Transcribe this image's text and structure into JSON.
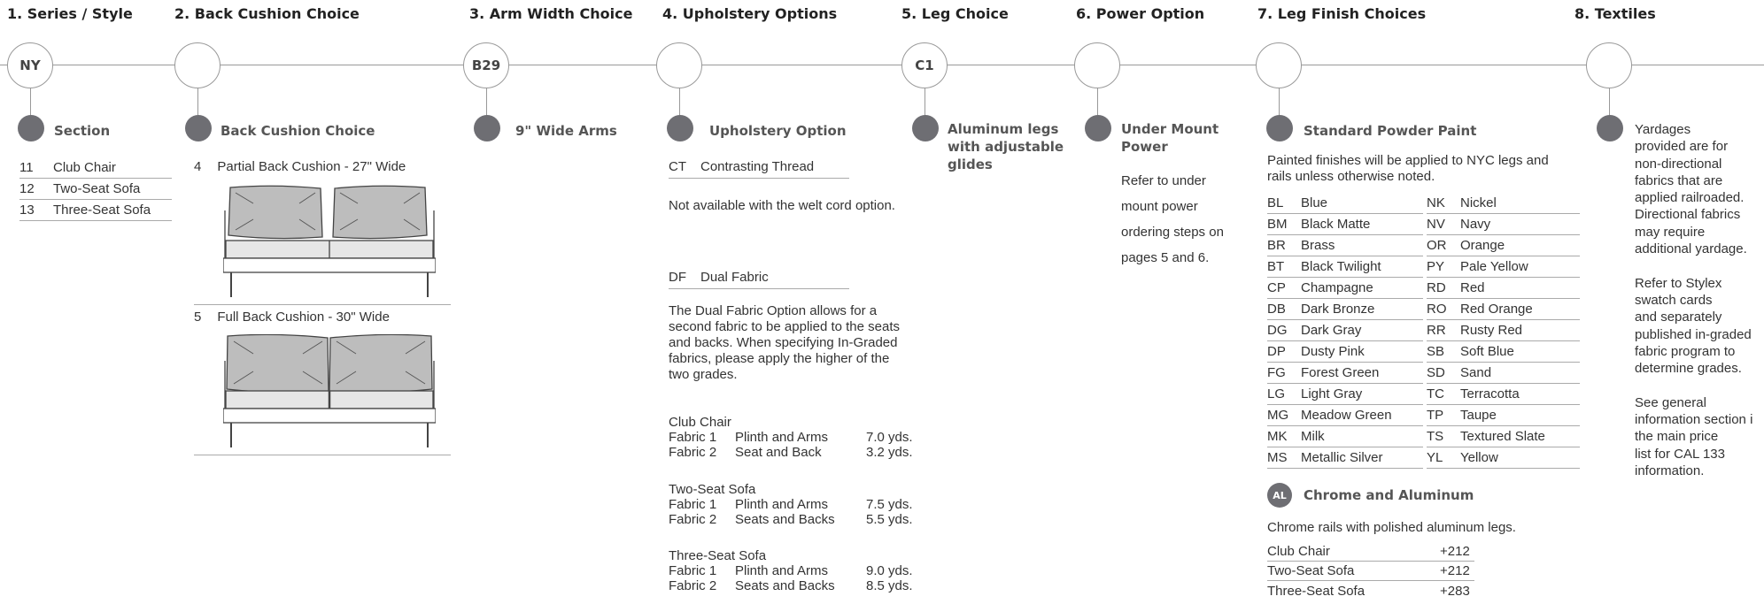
{
  "headers": [
    "1. Series / Style",
    "2. Back Cushion Choice",
    "3. Arm Width Choice",
    "4. Upholstery Options",
    "5. Leg Choice",
    "6. Power Option",
    "7. Leg Finish Choices",
    "8. Textiles"
  ],
  "circles": {
    "series": "NY",
    "arm": "B29",
    "leg": "C1"
  },
  "col1": {
    "heading": "Section",
    "items": [
      {
        "code": "11",
        "label": "Club Chair"
      },
      {
        "code": "12",
        "label": "Two-Seat Sofa"
      },
      {
        "code": "13",
        "label": "Three-Seat Sofa"
      }
    ]
  },
  "col2": {
    "heading": "Back Cushion Choice",
    "options": [
      {
        "code": "4",
        "label": "Partial Back Cushion - 27\" Wide"
      },
      {
        "code": "5",
        "label": "Full Back Cushion - 30\" Wide"
      }
    ]
  },
  "col3": {
    "heading": "9\" Wide Arms"
  },
  "col4": {
    "heading": "Upholstery Option",
    "ct_code": "CT",
    "ct_label": "Contrasting Thread",
    "ct_note": "Not available with the welt cord option.",
    "df_code": "DF",
    "df_label": "Dual Fabric",
    "df_desc": "The Dual Fabric Option allows for a second fabric to be applied to the seats and backs. When specifying In-Graded fabrics, please apply the higher of the two grades.",
    "groups": [
      {
        "title": "Club Chair",
        "rows": [
          {
            "f": "Fabric 1",
            "part": "Plinth and Arms",
            "yds": "7.0 yds."
          },
          {
            "f": "Fabric 2",
            "part": "Seat and Back",
            "yds": "3.2 yds."
          }
        ]
      },
      {
        "title": "Two-Seat Sofa",
        "rows": [
          {
            "f": "Fabric 1",
            "part": "Plinth and Arms",
            "yds": "7.5 yds."
          },
          {
            "f": "Fabric 2",
            "part": "Seats and Backs",
            "yds": "5.5 yds."
          }
        ]
      },
      {
        "title": "Three-Seat Sofa",
        "rows": [
          {
            "f": "Fabric 1",
            "part": "Plinth and Arms",
            "yds": "9.0 yds."
          },
          {
            "f": "Fabric 2",
            "part": "Seats and Backs",
            "yds": "8.5 yds."
          }
        ]
      }
    ]
  },
  "col5": {
    "heading_line1": "Aluminum legs",
    "heading_line2": "with adjustable",
    "heading_line3": "glides"
  },
  "col6": {
    "heading_line1": "Under Mount",
    "heading_line2": "Power",
    "lines": [
      "Refer to under",
      "mount power",
      "ordering steps on",
      "pages 5 and 6."
    ]
  },
  "col7": {
    "heading": "Standard Powder Paint",
    "note_line1": "Painted finishes will be applied to NYC legs and",
    "note_line2": "rails unless otherwise noted.",
    "colors_left": [
      {
        "c": "BL",
        "n": "Blue"
      },
      {
        "c": "BM",
        "n": "Black Matte"
      },
      {
        "c": "BR",
        "n": "Brass"
      },
      {
        "c": "BT",
        "n": "Black Twilight"
      },
      {
        "c": "CP",
        "n": "Champagne"
      },
      {
        "c": "DB",
        "n": "Dark Bronze"
      },
      {
        "c": "DG",
        "n": "Dark Gray"
      },
      {
        "c": "DP",
        "n": "Dusty Pink"
      },
      {
        "c": "FG",
        "n": "Forest Green"
      },
      {
        "c": "LG",
        "n": "Light Gray"
      },
      {
        "c": "MG",
        "n": "Meadow Green"
      },
      {
        "c": "MK",
        "n": "Milk"
      },
      {
        "c": "MS",
        "n": "Metallic Silver"
      }
    ],
    "colors_right": [
      {
        "c": "NK",
        "n": "Nickel"
      },
      {
        "c": "NV",
        "n": "Navy"
      },
      {
        "c": "OR",
        "n": "Orange"
      },
      {
        "c": "PY",
        "n": "Pale Yellow"
      },
      {
        "c": "RD",
        "n": "Red"
      },
      {
        "c": "RO",
        "n": "Red Orange"
      },
      {
        "c": "RR",
        "n": "Rusty Red"
      },
      {
        "c": "SB",
        "n": "Soft Blue"
      },
      {
        "c": "SD",
        "n": "Sand"
      },
      {
        "c": "TC",
        "n": "Terracotta"
      },
      {
        "c": "TP",
        "n": "Taupe"
      },
      {
        "c": "TS",
        "n": "Textured Slate"
      },
      {
        "c": "YL",
        "n": "Yellow"
      }
    ],
    "al_badge": "AL",
    "al_heading": "Chrome and Aluminum",
    "al_note": "Chrome rails with polished aluminum legs.",
    "upcharges": [
      {
        "item": "Club Chair",
        "price": "+212"
      },
      {
        "item": "Two-Seat Sofa",
        "price": "+212"
      },
      {
        "item": "Three-Seat Sofa",
        "price": "+283"
      }
    ]
  },
  "col8": {
    "lines": [
      "Yardages",
      "provided are for",
      "non-directional",
      "fabrics that are",
      "applied railroaded.",
      "Directional fabrics",
      "may require",
      "additional yardage.",
      "",
      "Refer to Stylex",
      "swatch cards",
      "and separately",
      "published in-graded",
      "fabric program to",
      "determine grades.",
      "",
      "See general",
      "information section i",
      "the main price",
      "list for CAL 133",
      "information."
    ]
  }
}
